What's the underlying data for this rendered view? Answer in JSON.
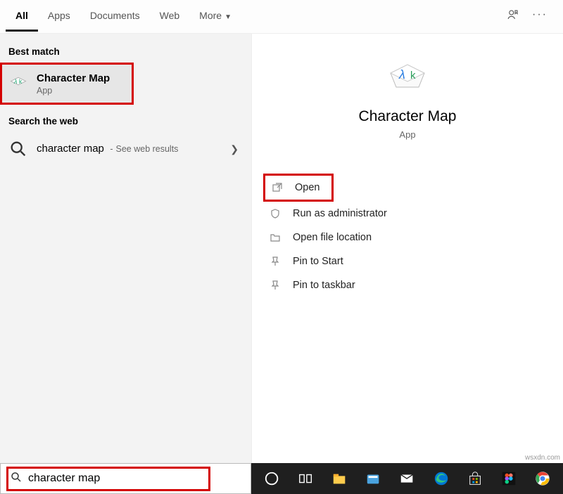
{
  "tabs": {
    "all": "All",
    "apps": "Apps",
    "docs": "Documents",
    "web": "Web",
    "more": "More"
  },
  "left": {
    "best_match_label": "Best match",
    "best": {
      "title": "Character Map",
      "sub": "App"
    },
    "search_web_label": "Search the web",
    "web_result": {
      "title": "character map",
      "sub": "See web results"
    }
  },
  "preview": {
    "title": "Character Map",
    "sub": "App"
  },
  "actions": {
    "open": "Open",
    "admin": "Run as administrator",
    "loc": "Open file location",
    "pin_start": "Pin to Start",
    "pin_tb": "Pin to taskbar"
  },
  "search": {
    "value": "character map"
  },
  "watermark": "wsxdn.com"
}
